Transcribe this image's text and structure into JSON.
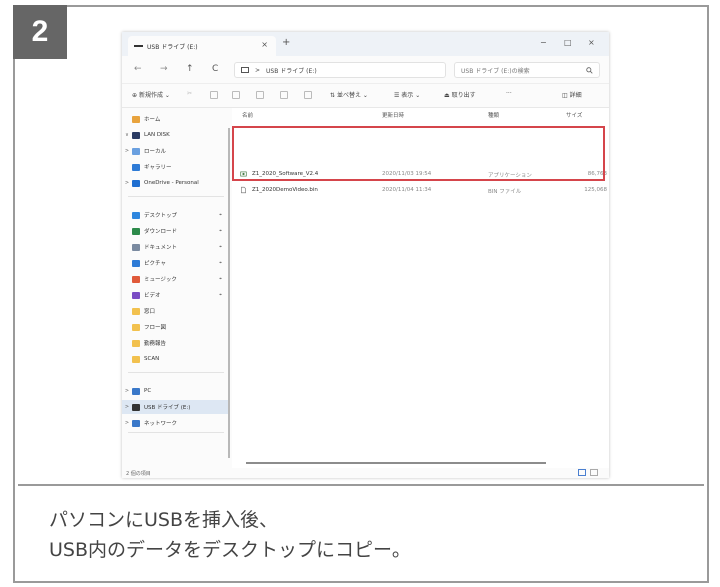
{
  "step_number": "2",
  "window": {
    "tab_title": "USB ドライブ (E:)",
    "tab_close": "×",
    "new_tab": "+",
    "minimize": "−",
    "maximize": "□",
    "close": "×"
  },
  "nav": {
    "back": "←",
    "forward": "→",
    "up": "↑",
    "refresh": "C",
    "address_separator": ">",
    "address_location": "USB ドライブ (E:)",
    "search_placeholder": "USB ドライブ (E:)の検索",
    "search_icon": "search-icon"
  },
  "toolbar": {
    "new_label": "新規作成",
    "sort_label": "並べ替え",
    "view_label": "表示",
    "eject_label": "取り出す",
    "more_label": "···",
    "details_label": "詳細"
  },
  "sidebar": {
    "items": [
      {
        "label": "ホーム",
        "chevron": "",
        "icon": "home-icon",
        "color": "#e8a33d",
        "pin": ""
      },
      {
        "label": "LAN DISK",
        "chevron": "∨",
        "icon": "nas-drive-icon",
        "color": "#2a3b63",
        "pin": ""
      },
      {
        "label": "ローカル",
        "chevron": ">",
        "icon": "local-folder-icon",
        "color": "#6aa0e0",
        "pin": ""
      },
      {
        "label": "ギャラリー",
        "chevron": "",
        "icon": "gallery-icon",
        "color": "#2e7bd6",
        "pin": ""
      },
      {
        "label": "OneDrive - Personal",
        "chevron": ">",
        "icon": "cloud-icon",
        "color": "#1f6fd1",
        "pin": ""
      },
      {
        "label": "デスクトップ",
        "chevron": "",
        "icon": "desktop-icon",
        "color": "#2e86de",
        "pin": "⌖"
      },
      {
        "label": "ダウンロード",
        "chevron": "",
        "icon": "download-icon",
        "color": "#2c8a4a",
        "pin": "⌖"
      },
      {
        "label": "ドキュメント",
        "chevron": "",
        "icon": "document-icon",
        "color": "#7a8aa0",
        "pin": "⌖"
      },
      {
        "label": "ピクチャ",
        "chevron": "",
        "icon": "pictures-icon",
        "color": "#2e7bd6",
        "pin": "⌖"
      },
      {
        "label": "ミュージック",
        "chevron": "",
        "icon": "music-icon",
        "color": "#e05a3a",
        "pin": "⌖"
      },
      {
        "label": "ビデオ",
        "chevron": "",
        "icon": "video-icon",
        "color": "#7a4cc4",
        "pin": "⌖"
      },
      {
        "label": "窓口",
        "chevron": "",
        "icon": "folder-icon",
        "color": "#f2c14e",
        "pin": ""
      },
      {
        "label": "フロー図",
        "chevron": "",
        "icon": "folder-icon",
        "color": "#f2c14e",
        "pin": ""
      },
      {
        "label": "勤務報告",
        "chevron": "",
        "icon": "folder-icon",
        "color": "#f2c14e",
        "pin": ""
      },
      {
        "label": "SCAN",
        "chevron": "",
        "icon": "folder-icon",
        "color": "#f2c14e",
        "pin": ""
      },
      {
        "label": "PC",
        "chevron": ">",
        "icon": "pc-icon",
        "color": "#3a78c9",
        "pin": ""
      },
      {
        "label": "USB ドライブ (E:)",
        "chevron": ">",
        "icon": "usb-drive-icon",
        "color": "#333333",
        "pin": ""
      },
      {
        "label": "ネットワーク",
        "chevron": ">",
        "icon": "network-icon",
        "color": "#3a78c9",
        "pin": ""
      }
    ]
  },
  "columns": {
    "name": "名前",
    "date": "更新日時",
    "type": "種類",
    "size": "サイズ"
  },
  "files": [
    {
      "name": "Z1_2020_Software_V2.4",
      "date": "2020/11/03 19:54",
      "type": "アプリケーション",
      "size": "86,763",
      "icon": "application-icon"
    },
    {
      "name": "Z1_2020DemoVideo.bin",
      "date": "2020/11/04 11:34",
      "type": "BIN ファイル",
      "size": "125,068",
      "icon": "file-icon"
    }
  ],
  "status": {
    "item_count": "2 個の項目"
  },
  "caption": {
    "line1": "パソコンにUSBを挿入後、",
    "line2": "USB内のデータをデスクトップにコピー。"
  },
  "colors": {
    "badge": "#666666",
    "highlight": "#d5454b",
    "frame": "#9a9a9a"
  }
}
